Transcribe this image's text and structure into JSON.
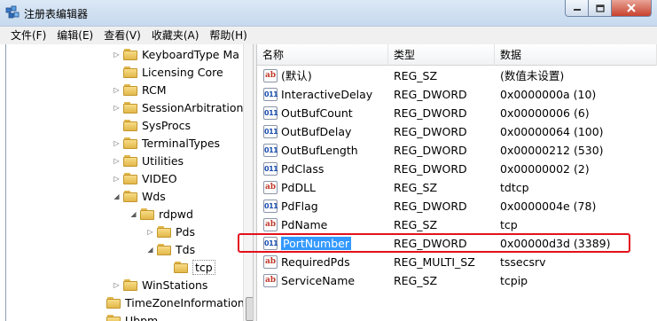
{
  "window": {
    "title": "注册表编辑器",
    "icon": "registry-editor-icon"
  },
  "menu": {
    "items": [
      "文件(F)",
      "编辑(E)",
      "查看(V)",
      "收藏夹(A)",
      "帮助(H)"
    ]
  },
  "tree": {
    "nodes": [
      {
        "label": "KeyboardType Ma",
        "expander": "collapsed"
      },
      {
        "label": "Licensing Core",
        "expander": "none"
      },
      {
        "label": "RCM",
        "expander": "collapsed"
      },
      {
        "label": "SessionArbitration",
        "expander": "collapsed"
      },
      {
        "label": "SysProcs",
        "expander": "none"
      },
      {
        "label": "TerminalTypes",
        "expander": "collapsed"
      },
      {
        "label": "Utilities",
        "expander": "collapsed"
      },
      {
        "label": "VIDEO",
        "expander": "collapsed"
      },
      {
        "label": "Wds",
        "expander": "expanded"
      },
      {
        "label": "rdpwd",
        "expander": "expanded"
      },
      {
        "label": "Pds",
        "expander": "collapsed"
      },
      {
        "label": "Tds",
        "expander": "expanded"
      },
      {
        "label": "tcp",
        "expander": "none"
      },
      {
        "label": "WinStations",
        "expander": "collapsed"
      },
      {
        "label": "TimeZoneInformation",
        "expander": "none"
      },
      {
        "label": "Ubpm",
        "expander": "none"
      }
    ],
    "selected": "tcp"
  },
  "list": {
    "columns": [
      "名称",
      "类型",
      "数据"
    ],
    "rows": [
      {
        "icon": "string-value-icon",
        "name": "(默认)",
        "type": "REG_SZ",
        "data": "(数值未设置)"
      },
      {
        "icon": "binary-value-icon",
        "name": "InteractiveDelay",
        "type": "REG_DWORD",
        "data": "0x0000000a (10)"
      },
      {
        "icon": "binary-value-icon",
        "name": "OutBufCount",
        "type": "REG_DWORD",
        "data": "0x00000006 (6)"
      },
      {
        "icon": "binary-value-icon",
        "name": "OutBufDelay",
        "type": "REG_DWORD",
        "data": "0x00000064 (100)"
      },
      {
        "icon": "binary-value-icon",
        "name": "OutBufLength",
        "type": "REG_DWORD",
        "data": "0x00000212 (530)"
      },
      {
        "icon": "binary-value-icon",
        "name": "PdClass",
        "type": "REG_DWORD",
        "data": "0x00000002 (2)"
      },
      {
        "icon": "string-value-icon",
        "name": "PdDLL",
        "type": "REG_SZ",
        "data": "tdtcp"
      },
      {
        "icon": "binary-value-icon",
        "name": "PdFlag",
        "type": "REG_DWORD",
        "data": "0x0000004e (78)"
      },
      {
        "icon": "string-value-icon",
        "name": "PdName",
        "type": "REG_SZ",
        "data": "tcp"
      },
      {
        "icon": "binary-value-icon",
        "name": "PortNumber",
        "type": "REG_DWORD",
        "data": "0x00000d3d (3389)"
      },
      {
        "icon": "string-value-icon",
        "name": "RequiredPds",
        "type": "REG_MULTI_SZ",
        "data": "tssecsrv"
      },
      {
        "icon": "string-value-icon",
        "name": "ServiceName",
        "type": "REG_SZ",
        "data": "tcpip"
      }
    ],
    "selected": "PortNumber",
    "highlight_color": "#e3111d",
    "selection_color": "#3399ff"
  }
}
